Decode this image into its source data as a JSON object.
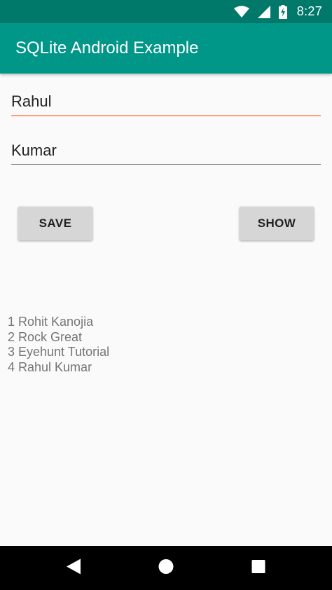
{
  "status_bar": {
    "time": "8:27",
    "icons": [
      "wifi-icon",
      "cell-signal-icon",
      "battery-charging-icon"
    ]
  },
  "app_bar": {
    "title": "SQLite Android Example"
  },
  "form": {
    "first_name_value": "Rahul",
    "last_name_value": "Kumar"
  },
  "buttons": {
    "save_label": "SAVE",
    "show_label": "SHOW"
  },
  "records": [
    "1 Rohit Kanojia",
    "2 Rock Great",
    "3 Eyehunt Tutorial",
    "4 Rahul Kumar"
  ],
  "nav_bar": {
    "icons": [
      "back-icon",
      "home-icon",
      "recents-icon"
    ]
  },
  "colors": {
    "status_bar": "#00796b",
    "app_bar": "#009688",
    "focused_underline": "#ff9e80",
    "button": "#d6d6d6"
  }
}
